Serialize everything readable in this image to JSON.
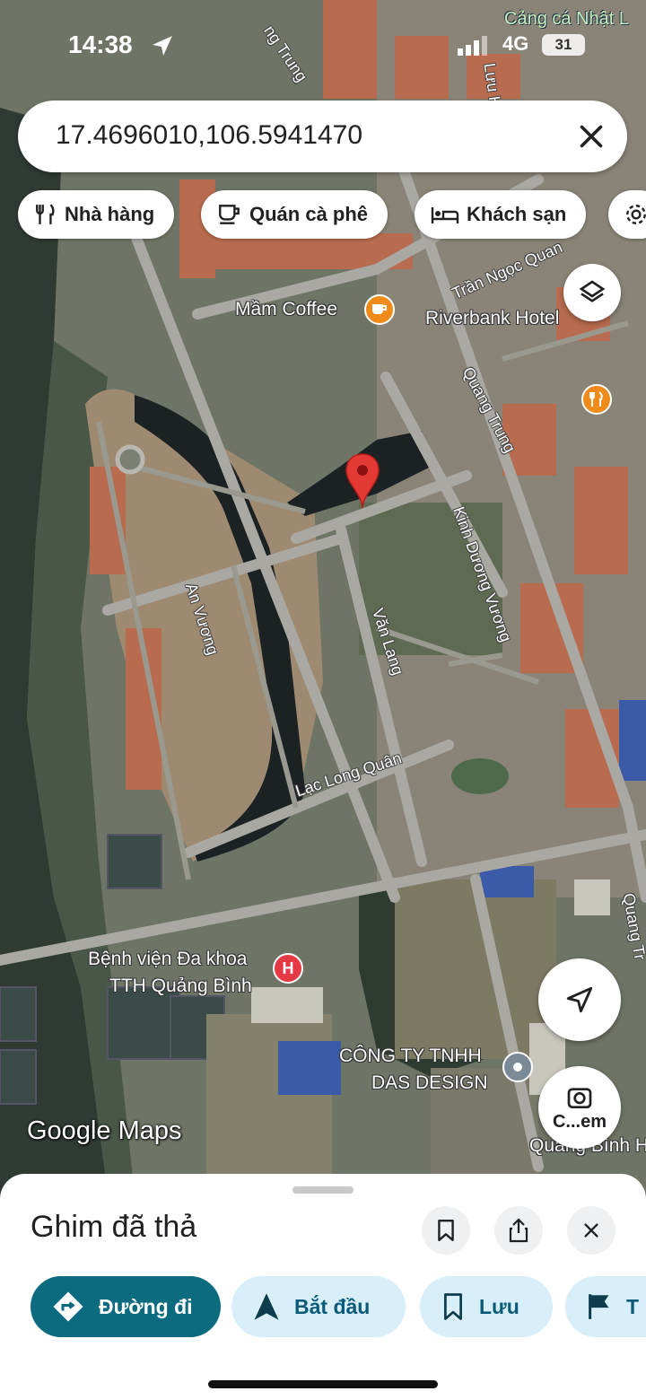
{
  "status_bar": {
    "time": "14:38",
    "network": "4G",
    "battery": "31"
  },
  "map_overlay_label": "Cảng cá Nhật L",
  "search": {
    "value": "17.4696010,106.5941470"
  },
  "chips": [
    {
      "label": "Nhà hàng",
      "icon": "restaurant-icon"
    },
    {
      "label": "Quán cà phê",
      "icon": "coffee-icon"
    },
    {
      "label": "Khách sạn",
      "icon": "hotel-icon"
    }
  ],
  "map": {
    "places": {
      "mam_coffee": "Mầm Coffee",
      "riverbank_hotel": "Riverbank Hotel",
      "hospital_line1": "Bệnh viện Đa khoa",
      "hospital_line2": "TTH Quảng Bình",
      "company_line1": "CÔNG TY TNHH",
      "company_line2": "DAS DESIGN",
      "lens_label": "C...em",
      "bottom_right": "Quảng Bình H"
    },
    "streets": {
      "quang_trung_top": "ng Trung",
      "luu_h": "Lưu H",
      "tran_ngoc_quang": "Trần Ngọc Quan",
      "quang_trung": "Quang Trung",
      "kinh_duong_vuong": "Kinh Dương Vương",
      "an_vuong": "An Vương",
      "van_lang": "Văn Lang",
      "lac_long_quan": "Lạc Long Quân",
      "quang_right": "Quang Tr"
    },
    "attribution": "Google Maps",
    "pin_color": "#e53935"
  },
  "sheet": {
    "title": "Ghim đã thả",
    "actions": [
      {
        "label": "Đường đi",
        "icon": "directions-icon"
      },
      {
        "label": "Bắt đầu",
        "icon": "navigation-icon"
      },
      {
        "label": "Lưu",
        "icon": "bookmark-icon"
      },
      {
        "label": "T",
        "icon": "flag-icon"
      }
    ]
  }
}
